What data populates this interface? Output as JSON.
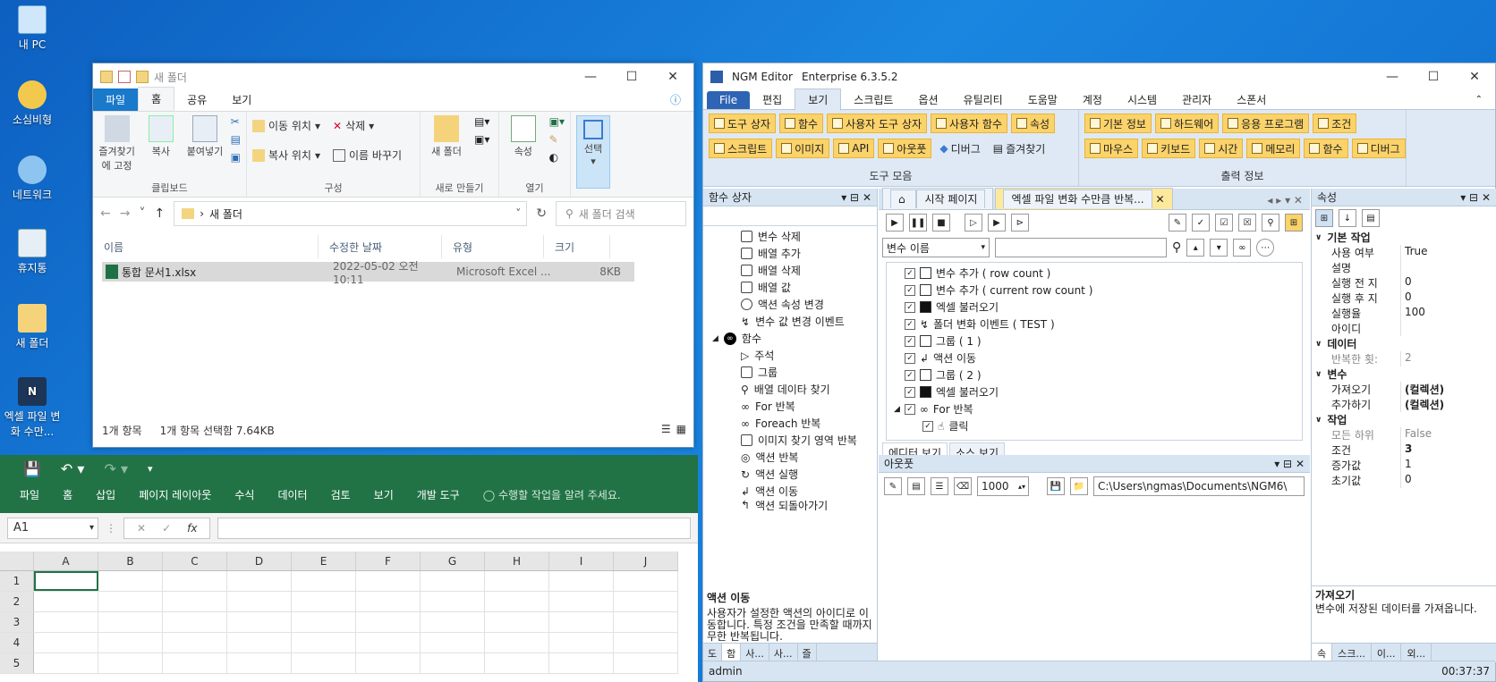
{
  "desktop": {
    "icons": [
      {
        "label": "내 PC"
      },
      {
        "label": "소심비형"
      },
      {
        "label": "네트워크"
      },
      {
        "label": "휴지통"
      },
      {
        "label": "새 폴더"
      },
      {
        "label": "엑셀 파일 변화 수만..."
      }
    ]
  },
  "explorer": {
    "title": "새 폴더",
    "tabs": [
      "파일",
      "홈",
      "공유",
      "보기"
    ],
    "ribbon": {
      "clipboard": {
        "pin": "즐겨찾기에 고정",
        "copy": "복사",
        "paste": "붙여넣기",
        "group": "클립보드"
      },
      "organize": {
        "move": "이동 위치",
        "copy": "복사 위치",
        "delete": "삭제",
        "rename": "이름 바꾸기",
        "group": "구성"
      },
      "new": {
        "folder": "새 폴더",
        "group": "새로 만들기"
      },
      "open": {
        "props": "속성",
        "group": "열기"
      },
      "select": {
        "label": "선택"
      }
    },
    "address": "새 폴더",
    "search_placeholder": "새 폴더 검색",
    "columns": [
      "이름",
      "수정한 날짜",
      "유형",
      "크기"
    ],
    "files": [
      {
        "name": "통합 문서1.xlsx",
        "date": "2022-05-02 오전 10:11",
        "type": "Microsoft Excel ...",
        "size": "8KB"
      }
    ],
    "status": {
      "count": "1개 항목",
      "selected": "1개 항목 선택함 7.64KB"
    }
  },
  "excel": {
    "menu": [
      "파일",
      "홈",
      "삽입",
      "페이지 레이아웃",
      "수식",
      "데이터",
      "검토",
      "보기",
      "개발 도구"
    ],
    "tellme": "수행할 작업을 알려 주세요.",
    "namebox": "A1",
    "columns": [
      "A",
      "B",
      "C",
      "D",
      "E",
      "F",
      "G",
      "H",
      "I",
      "J"
    ],
    "rows": [
      "1",
      "2",
      "3",
      "4",
      "5"
    ]
  },
  "ngm": {
    "title": "NGM Editor",
    "edition": "Enterprise 6.3.5.2",
    "menu": [
      "File",
      "편집",
      "보기",
      "스크립트",
      "옵션",
      "유틸리티",
      "도움말",
      "계정",
      "시스템",
      "관리자",
      "스폰서"
    ],
    "ribbon": {
      "tools_row1": [
        "도구 상자",
        "함수",
        "사용자 도구 상자",
        "사용자 함수",
        "속성"
      ],
      "tools_row2": [
        "스크립트",
        "이미지",
        "API",
        "아웃풋",
        "디버그",
        "즐겨찾기"
      ],
      "tools_group": "도구 모음",
      "out_row1": [
        "기본 정보",
        "하드웨어",
        "응용 프로그램",
        "조건"
      ],
      "out_row2": [
        "마우스",
        "키보드",
        "시간",
        "메모리",
        "함수",
        "디버그"
      ],
      "out_group": "출력 정보"
    },
    "left": {
      "title": "함수 상자",
      "items": [
        "변수 삭제",
        "배열 추가",
        "배열 삭제",
        "배열 값",
        "액션 속성 변경",
        "변수 값 변경 이벤트"
      ],
      "group": "함수",
      "group_items": [
        "주석",
        "그룹",
        "배열 데이타 찾기",
        "For 반복",
        "Foreach 반복",
        "이미지 찾기 영역 반복",
        "액션 반복",
        "액션 실행",
        "액션 이동",
        "액션 되돌아가기"
      ],
      "desc_title": "액션 이동",
      "desc_text": "사용자가 설정한 액션의 아이디로 이동합니다. 특정 조건을 만족할 때까지 무한 반복됩니다.",
      "tabs": [
        "도",
        "함",
        "사...",
        "사...",
        "즐"
      ]
    },
    "center": {
      "tabs": [
        "시작 페이지",
        "엑셀 파일 변화 수만큼 반복..."
      ],
      "filter_select": "변수 이름",
      "items": [
        "변수 추가 ( row count )",
        "변수 추가 ( current row count )",
        "엑셀 불러오기",
        "폴더 변화 이벤트 ( TEST )",
        "그룹 ( 1 )",
        "액션 이동",
        "그룹 ( 2 )",
        "엑셀 불러오기",
        "For 반복",
        "클릭"
      ],
      "view_tabs": [
        "에디터 보기",
        "소스 보기"
      ],
      "output_title": "아웃풋",
      "output_count": "1000",
      "output_path": "C:\\Users\\ngmas\\Documents\\NGM6\\"
    },
    "right": {
      "title": "속성",
      "cat_basic": "기본 작업",
      "basic": [
        {
          "k": "사용 여부",
          "v": "True"
        },
        {
          "k": "설명",
          "v": ""
        },
        {
          "k": "실행 전 지",
          "v": "0"
        },
        {
          "k": "실행 후 지",
          "v": "0"
        },
        {
          "k": "실행율",
          "v": "100"
        },
        {
          "k": "아이디",
          "v": ""
        }
      ],
      "cat_data": "데이터",
      "data": [
        {
          "k": "반복한 횟:",
          "v": "2"
        }
      ],
      "cat_var": "변수",
      "var": [
        {
          "k": "가져오기",
          "v": "(컬렉션)"
        },
        {
          "k": "추가하기",
          "v": "(컬렉션)"
        }
      ],
      "cat_work": "작업",
      "work": [
        {
          "k": "모든 하위",
          "v": "False"
        },
        {
          "k": "조건",
          "v": "3"
        },
        {
          "k": "증가값",
          "v": "1"
        },
        {
          "k": "초기값",
          "v": "0"
        }
      ],
      "desc_title": "가져오기",
      "desc_text": "변수에 저장된 데이터를 가져옵니다.",
      "tabs": [
        "속",
        "스크...",
        "이...",
        "외..."
      ]
    },
    "status": {
      "user": "admin",
      "time": "00:37:37"
    }
  }
}
